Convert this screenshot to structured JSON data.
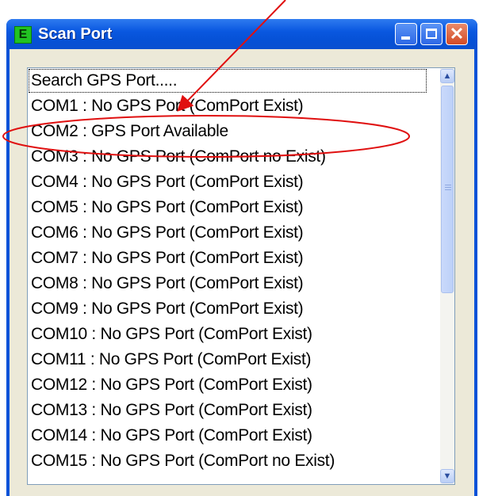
{
  "window": {
    "title": "Scan Port",
    "app_icon_letter": "E",
    "buttons": {
      "minimize": "minimize",
      "maximize": "maximize",
      "close": "✕"
    }
  },
  "listbox": {
    "items": [
      "Search GPS Port.....",
      "COM1 : No GPS Port (ComPort Exist)",
      "COM2 : GPS Port  Available",
      "COM3 : No GPS Port (ComPort no Exist)",
      "COM4 : No GPS Port (ComPort Exist)",
      "COM5 : No GPS Port (ComPort Exist)",
      "COM6 : No GPS Port (ComPort Exist)",
      "COM7 : No GPS Port (ComPort Exist)",
      "COM8 : No GPS Port (ComPort Exist)",
      "COM9 : No GPS Port (ComPort Exist)",
      "COM10 : No GPS Port (ComPort Exist)",
      "COM11 : No GPS Port (ComPort Exist)",
      "COM12 : No GPS Port (ComPort Exist)",
      "COM13 : No GPS Port (ComPort Exist)",
      "COM14 : No GPS Port (ComPort Exist)",
      "COM15 : No GPS Port (ComPort no Exist)"
    ]
  },
  "annotation": {
    "color": "#e01010"
  }
}
